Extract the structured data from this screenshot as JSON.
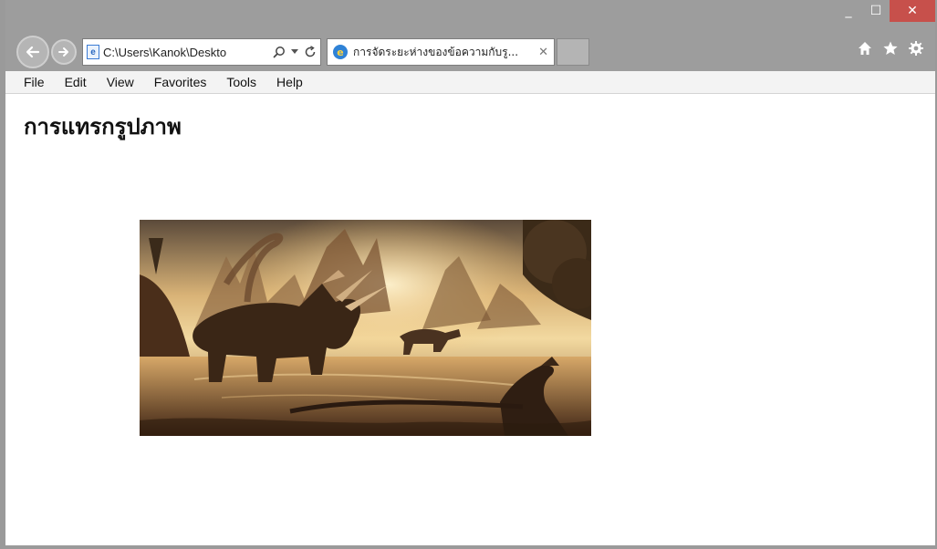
{
  "window": {
    "controls": {
      "minimize": "_",
      "maximize": "☐",
      "close": "✕"
    }
  },
  "address_bar": {
    "url": "C:\\Users\\Kanok\\Deskto"
  },
  "tab": {
    "title": "การจัดระยะห่างของข้อความกับรู..."
  },
  "menu": {
    "items": [
      "File",
      "Edit",
      "View",
      "Favorites",
      "Tools",
      "Help"
    ]
  },
  "page": {
    "heading": "การแทรกรูปภาพ"
  },
  "colors": {
    "chrome": "#9d9d9d",
    "close_button": "#c7504b",
    "menu_bar": "#f3f3f3"
  },
  "icons": [
    "back-arrow-icon",
    "forward-arrow-icon",
    "page-icon",
    "search-icon",
    "refresh-icon",
    "ie-icon",
    "home-icon",
    "favorites-star-icon",
    "gear-icon"
  ]
}
